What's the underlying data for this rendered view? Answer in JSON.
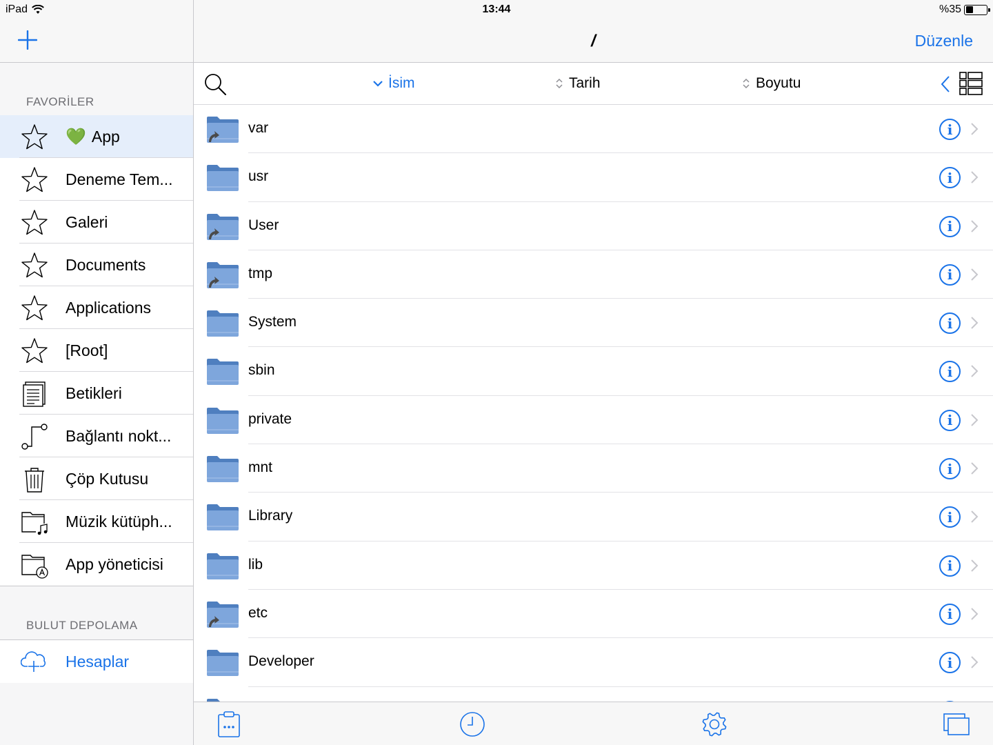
{
  "status_bar": {
    "device": "iPad",
    "time": "13:44",
    "battery": "%35",
    "battery_level": 0.35
  },
  "sidebar": {
    "favorites_title": "FAVORİLER",
    "favorites": [
      {
        "label": "App",
        "icon": "star-icon",
        "emoji": "💚",
        "selected": true
      },
      {
        "label": "Deneme Tem...",
        "icon": "star-icon"
      },
      {
        "label": "Galeri",
        "icon": "star-icon"
      },
      {
        "label": "Documents",
        "icon": "star-icon"
      },
      {
        "label": "Applications",
        "icon": "star-icon"
      },
      {
        "label": "[Root]",
        "icon": "star-icon"
      },
      {
        "label": "Betikleri",
        "icon": "script-icon"
      },
      {
        "label": "Bağlantı nokt...",
        "icon": "connection-icon"
      },
      {
        "label": "Çöp Kutusu",
        "icon": "trash-icon"
      },
      {
        "label": "Müzik kütüph...",
        "icon": "music-folder-icon"
      },
      {
        "label": "App yöneticisi",
        "icon": "app-folder-icon"
      }
    ],
    "cloud_title": "BULUT DEPOLAMA",
    "cloud_item": "Hesaplar"
  },
  "header": {
    "path": "/",
    "edit": "Düzenle"
  },
  "sort": {
    "name": "İsim",
    "date": "Tarih",
    "size": "Boyutu"
  },
  "files": [
    {
      "name": "var",
      "link": true
    },
    {
      "name": "usr",
      "link": false
    },
    {
      "name": "User",
      "link": true
    },
    {
      "name": "tmp",
      "link": true
    },
    {
      "name": "System",
      "link": false
    },
    {
      "name": "sbin",
      "link": false
    },
    {
      "name": "private",
      "link": false
    },
    {
      "name": "mnt",
      "link": false
    },
    {
      "name": "Library",
      "link": false
    },
    {
      "name": "lib",
      "link": false
    },
    {
      "name": "etc",
      "link": true
    },
    {
      "name": "Developer",
      "link": false
    },
    {
      "name": "",
      "link": false
    }
  ],
  "colors": {
    "accent": "#1a73e8",
    "folder": "#7ea6dc",
    "folder_dark": "#4f7fbf",
    "selected": "#e5eefb"
  }
}
